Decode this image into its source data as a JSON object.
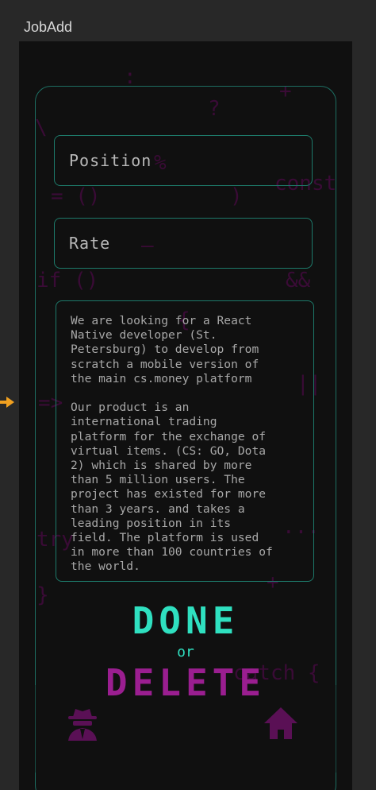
{
  "frame_title": "JobAdd",
  "background_symbols": [
    ":",
    "+",
    "?",
    "\\",
    "%",
    "const",
    "= ()",
    ")",
    "—",
    "if ()",
    "&&",
    "{",
    "=>",
    "||",
    "try",
    "...",
    "+",
    "}",
    "catch {"
  ],
  "form": {
    "position_placeholder": "Position",
    "rate_placeholder": "Rate",
    "description": "We are looking for a React\nNative developer (St.\nPetersburg) to develop from\nscratch a mobile version of\nthe main cs.money platform\n\nOur product is an\ninternational trading\nplatform for the exchange of\nvirtual items. (CS: GO, Dota\n2) which is shared by more\nthan 5 million users. The\nproject has existed for more\nthan 3 years. and takes a\nleading position in its\nfield. The platform is used\nin more than 100 countries of\nthe world."
  },
  "actions": {
    "done_label": "DONE",
    "or_label": "or",
    "delete_label": "DELETE"
  },
  "tabbar": {
    "left_icon": "spy-agent-icon",
    "right_icon": "home-icon"
  },
  "colors": {
    "accent": "#2fe0c0",
    "danger": "#9a1e90",
    "border": "#1d7a6a",
    "background": "#101010"
  }
}
